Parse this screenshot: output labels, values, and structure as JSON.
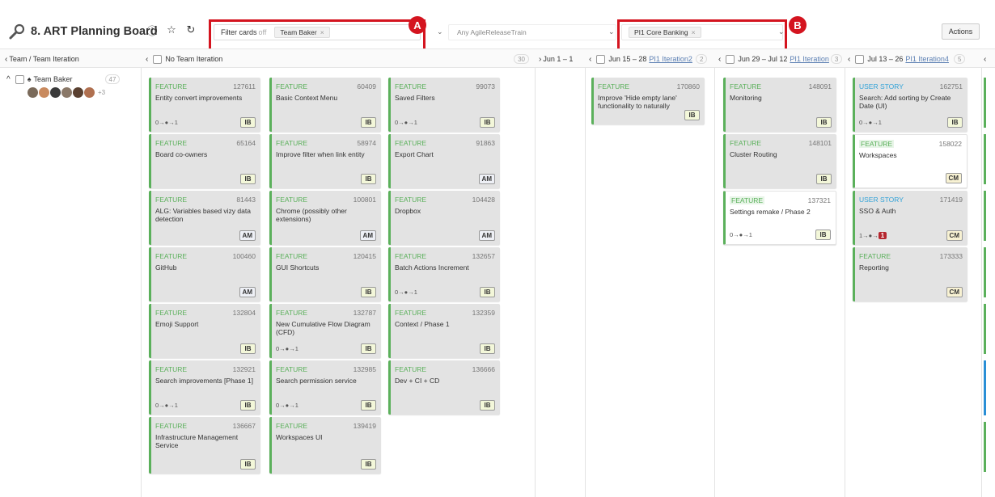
{
  "header": {
    "title": "8. ART Planning Board",
    "filter_label": "Filter cards",
    "filter_state": "off",
    "team_tag": "Team Baker",
    "art_select": "Any AgileReleaseTrain",
    "pi_tag": "PI1 Core Banking",
    "actions_label": "Actions",
    "callout_a": "A",
    "callout_b": "B"
  },
  "columns": {
    "team_header": "Team / Team Iteration",
    "no_iter_label": "No Team Iteration",
    "no_iter_count": "30",
    "jun1_label": "Jun 1 – 1",
    "iter2_dates": "Jun 15 – 28",
    "iter2_link": "PI1 Iteration2",
    "iter2_count": "2",
    "iter3_dates": "Jun 29 – Jul 12",
    "iter3_link": "PI1 Iteration",
    "iter3_count": "3",
    "iter4_dates": "Jul 13 – 26",
    "iter4_link": "PI1 Iteration4",
    "iter4_count": "5"
  },
  "lane": {
    "team_name": "Team Baker",
    "team_count": "47",
    "extra_members": "+3"
  },
  "cards": [
    {
      "type": "FEATURE",
      "num": "127611",
      "title": "Entity convert improvements",
      "deps": "0→●→1",
      "tag": "IB"
    },
    {
      "type": "FEATURE",
      "num": "60409",
      "title": "Basic Context Menu",
      "deps": "",
      "tag": "IB"
    },
    {
      "type": "FEATURE",
      "num": "99073",
      "title": "Saved Filters",
      "deps": "0→●→1",
      "tag": "IB"
    },
    {
      "type": "FEATURE",
      "num": "65164",
      "title": "Board co-owners",
      "deps": "",
      "tag": "IB"
    },
    {
      "type": "FEATURE",
      "num": "58974",
      "title": "Improve filter when link entity",
      "deps": "",
      "tag": "IB"
    },
    {
      "type": "FEATURE",
      "num": "91863",
      "title": "Export Chart",
      "deps": "",
      "tag": "AM"
    },
    {
      "type": "FEATURE",
      "num": "81443",
      "title": "ALG: Variables based vizy data detection",
      "deps": "",
      "tag": "AM"
    },
    {
      "type": "FEATURE",
      "num": "100801",
      "title": "Chrome (possibly other extensions)",
      "deps": "",
      "tag": "AM"
    },
    {
      "type": "FEATURE",
      "num": "104428",
      "title": "Dropbox",
      "deps": "",
      "tag": "AM"
    },
    {
      "type": "FEATURE",
      "num": "100460",
      "title": "GitHub",
      "deps": "",
      "tag": "AM"
    },
    {
      "type": "FEATURE",
      "num": "120415",
      "title": "GUI Shortcuts",
      "deps": "",
      "tag": "IB"
    },
    {
      "type": "FEATURE",
      "num": "132657",
      "title": "Batch Actions Increment",
      "deps": "0→●→1",
      "tag": "IB"
    },
    {
      "type": "FEATURE",
      "num": "132804",
      "title": "Emoji Support",
      "deps": "",
      "tag": "IB"
    },
    {
      "type": "FEATURE",
      "num": "132787",
      "title": "New Cumulative Flow Diagram (CFD)",
      "deps": "0→●→1",
      "tag": "IB"
    },
    {
      "type": "FEATURE",
      "num": "132359",
      "title": "Context / Phase 1",
      "deps": "",
      "tag": "IB"
    },
    {
      "type": "FEATURE",
      "num": "132921",
      "title": "Search improvements [Phase 1]",
      "deps": "0→●→1",
      "tag": "IB"
    },
    {
      "type": "FEATURE",
      "num": "132985",
      "title": "Search permission service",
      "deps": "0→●→1",
      "tag": "IB"
    },
    {
      "type": "FEATURE",
      "num": "136666",
      "title": "Dev + CI + CD",
      "deps": "",
      "tag": "IB"
    },
    {
      "type": "FEATURE",
      "num": "136667",
      "title": "Infrastructure Management Service",
      "deps": "",
      "tag": "IB"
    },
    {
      "type": "FEATURE",
      "num": "139419",
      "title": "Workspaces UI",
      "deps": "",
      "tag": "IB"
    },
    {
      "type": "FEATURE",
      "num": "170860",
      "title": "Improve 'Hide empty lane' functionality to naturally",
      "deps": "",
      "tag": "IB"
    },
    {
      "type": "FEATURE",
      "num": "148091",
      "title": "Monitoring",
      "deps": "",
      "tag": "IB"
    },
    {
      "type": "FEATURE",
      "num": "148101",
      "title": "Cluster Routing",
      "deps": "",
      "tag": "IB"
    },
    {
      "type": "FEATURE",
      "num": "137321",
      "title": "Settings remake / Phase 2",
      "deps": "0→●→1",
      "tag": "IB"
    },
    {
      "type": "USER STORY",
      "num": "162751",
      "title": "Search: Add sorting by Create Date (UI)",
      "deps": "0→●→1",
      "tag": "IB"
    },
    {
      "type": "FEATURE",
      "num": "158022",
      "title": "Workspaces",
      "deps": "",
      "tag": "CM"
    },
    {
      "type": "USER STORY",
      "num": "171419",
      "title": "SSO & Auth",
      "deps": "1→●→",
      "deps_badge": "1",
      "tag": "CM"
    },
    {
      "type": "FEATURE",
      "num": "173333",
      "title": "Reporting",
      "deps": "",
      "tag": "CM"
    }
  ]
}
